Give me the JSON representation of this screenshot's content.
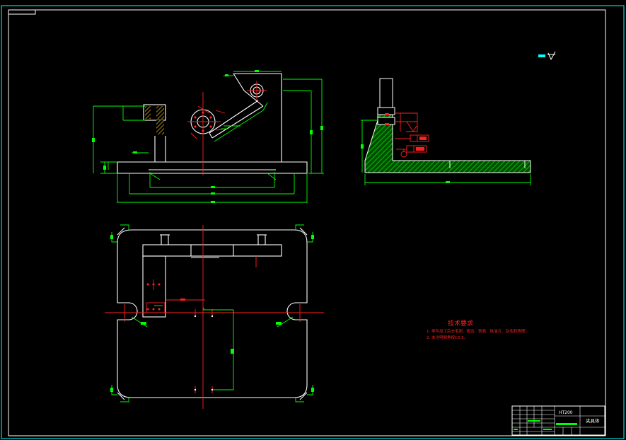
{
  "tech_requirements": {
    "title": "技术要求",
    "lines": [
      "1. 零件加工后去毛刺、锐边、表面、除油污、及毛刺清理；",
      "2. 未注明倒角按C0.5。"
    ]
  },
  "title_block": {
    "material": "HT200",
    "name": "夹具体"
  },
  "colors": {
    "background": "#000000",
    "outline": "#ffffff",
    "dimension": "#00ff00",
    "centerline": "#ff0000",
    "frame": "#00ffff",
    "hatch": "#00c800",
    "text_red": "#ff2020"
  }
}
